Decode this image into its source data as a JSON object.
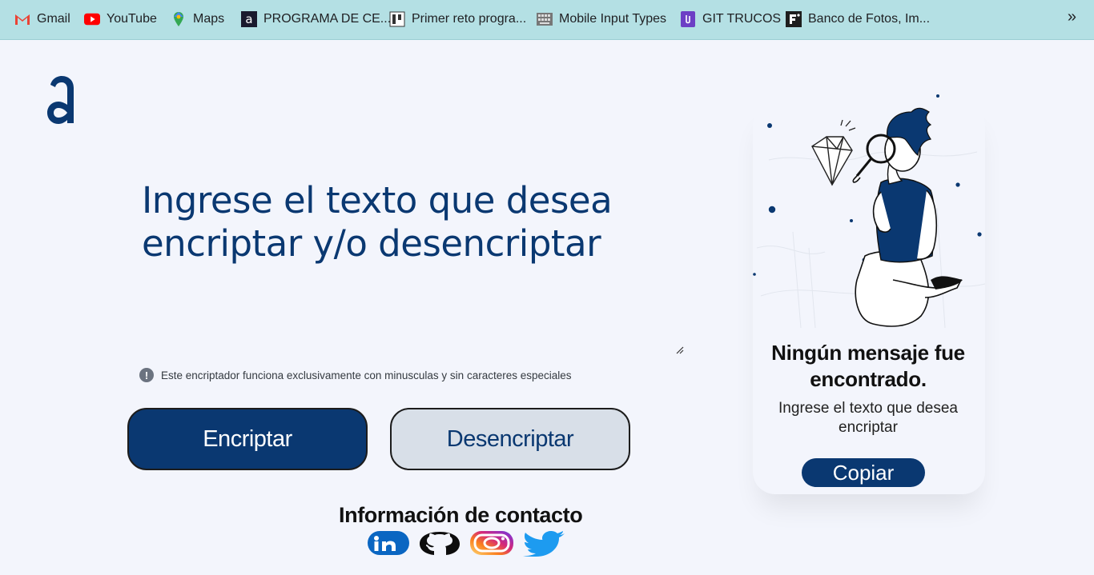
{
  "bookmarks": [
    {
      "label": "Gmail",
      "icon": "gmail-icon"
    },
    {
      "label": "YouTube",
      "icon": "youtube-icon"
    },
    {
      "label": "Maps",
      "icon": "maps-icon"
    },
    {
      "label": "PROGRAMA DE CE...",
      "icon": "alura-icon"
    },
    {
      "label": "Primer reto progra...",
      "icon": "trello-icon"
    },
    {
      "label": "Mobile Input Types",
      "icon": "keyboard-icon"
    },
    {
      "label": "GIT TRUCOS",
      "icon": "clip-icon"
    },
    {
      "label": "Banco de Fotos, Im...",
      "icon": "freepik-icon"
    }
  ],
  "bookmarks_more": "»",
  "main": {
    "headline": "Ingrese el texto que desea encriptar y/o desencriptar",
    "note": "Este encriptador funciona exclusivamente con minusculas y sin caracteres especiales",
    "note_icon": "!",
    "encrypt_label": "Encriptar",
    "decrypt_label": "Desencriptar"
  },
  "contact": {
    "title": "Información de contacto",
    "links": [
      "linkedin-icon",
      "github-icon",
      "instagram-icon",
      "twitter-icon"
    ]
  },
  "panel": {
    "title": "Ningún mensaje fue encontrado.",
    "subtitle": "Ingrese el texto que desea encriptar",
    "copy_label": "Copiar"
  },
  "colors": {
    "brand": "#0a3871",
    "background": "#f3f5fc",
    "bookmark_bar": "#b4e0e4",
    "secondary_button": "#d8dfe8"
  }
}
